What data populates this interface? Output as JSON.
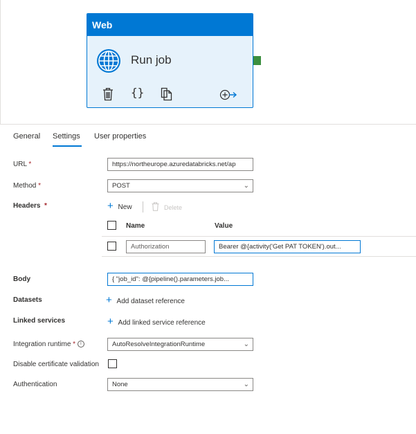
{
  "activity": {
    "type_label": "Web",
    "name": "Run job",
    "icons": [
      "delete-icon",
      "code-icon",
      "copy-icon",
      "add-output-icon"
    ]
  },
  "tabs": [
    {
      "label": "General",
      "selected": false
    },
    {
      "label": "Settings",
      "selected": true
    },
    {
      "label": "User properties",
      "selected": false
    }
  ],
  "form": {
    "url": {
      "label": "URL",
      "required_mark": "*",
      "value": "https://northeurope.azuredatabricks.net/ap"
    },
    "method": {
      "label": "Method",
      "required_mark": "*",
      "value": "POST"
    },
    "headers": {
      "label": "Headers",
      "required_mark": "*",
      "new_label": "New",
      "delete_label": "Delete",
      "columns": [
        "Name",
        "Value"
      ],
      "rows": [
        {
          "name": "Authorization",
          "value": "Bearer @{activity('Get PAT TOKEN').out..."
        }
      ]
    },
    "body": {
      "label": "Body",
      "value": "{ \"job_id\": @{pipeline().parameters.job..."
    },
    "datasets": {
      "label": "Datasets",
      "add_label": "Add dataset reference"
    },
    "linked_services": {
      "label": "Linked services",
      "add_label": "Add linked service reference"
    },
    "integration_runtime": {
      "label": "Integration runtime",
      "required_mark": "*",
      "value": "AutoResolveIntegrationRuntime"
    },
    "disable_cert": {
      "label": "Disable certificate validation",
      "checked": false
    },
    "authentication": {
      "label": "Authentication",
      "value": "None"
    }
  },
  "colors": {
    "accent": "#0078d4",
    "success": "#3c8f3f",
    "required": "#a4262c"
  }
}
